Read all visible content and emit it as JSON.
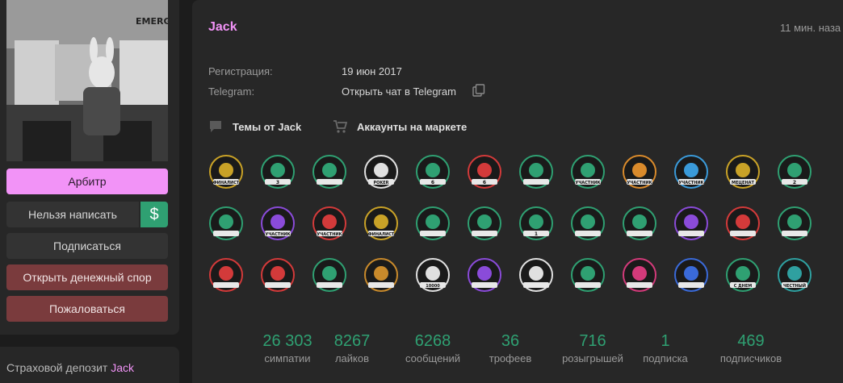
{
  "profile": {
    "username": "Jack",
    "last_seen": "11 мин. наза",
    "registration_label": "Регистрация:",
    "registration_value": "19 июн 2017",
    "telegram_label": "Telegram:",
    "telegram_value": "Открыть чат в Telegram",
    "threads_link": "Темы от Jack",
    "market_link": "Аккаунты на маркете"
  },
  "sidebar": {
    "arbiter": "Арбитр",
    "no_write": "Нельзя написать",
    "dollar": "$",
    "subscribe": "Подписаться",
    "dispute": "Открыть денежный спор",
    "complain": "Пожаловаться"
  },
  "deposit": {
    "label": "Страховой депозит",
    "name": "Jack"
  },
  "stats": [
    {
      "value": "26 303",
      "label": "симпатии"
    },
    {
      "value": "8267",
      "label": "лайков"
    },
    {
      "value": "6268",
      "label": "сообщений"
    },
    {
      "value": "36",
      "label": "трофеев"
    },
    {
      "value": "716",
      "label": "розыгрышей"
    },
    {
      "value": "1",
      "label": "подписка"
    },
    {
      "value": "469",
      "label": "подписчиков"
    }
  ],
  "trophies": [
    {
      "name": "trophy-finalist",
      "color": "#c9a227",
      "text": "ФИНАЛИСТ"
    },
    {
      "name": "trophy-3-years",
      "color": "#2fa072",
      "text": "3"
    },
    {
      "name": "trophy-truck",
      "color": "#2fa072",
      "text": ""
    },
    {
      "name": "trophy-poker",
      "color": "#e0e0e0",
      "text": "POKER"
    },
    {
      "name": "trophy-six",
      "color": "#2fa072",
      "text": "6"
    },
    {
      "name": "trophy-forum",
      "color": "#d33a3a",
      "text": "6"
    },
    {
      "name": "trophy-skull",
      "color": "#2fa072",
      "text": ""
    },
    {
      "name": "trophy-eye",
      "color": "#2fa072",
      "text": "УЧАСТНИК"
    },
    {
      "name": "trophy-pyramid",
      "color": "#d98a2b",
      "text": "УЧАСТНИК"
    },
    {
      "name": "trophy-shark",
      "color": "#3a9ad9",
      "text": "УЧАСТНИК"
    },
    {
      "name": "trophy-patron",
      "color": "#c9a227",
      "text": "МЕЦЕНАТ"
    },
    {
      "name": "trophy-2-years",
      "color": "#2fa072",
      "text": "2"
    },
    {
      "name": "trophy-triangle",
      "color": "#2fa072",
      "text": ""
    },
    {
      "name": "trophy-brain",
      "color": "#8a4bd9",
      "text": "УЧАСТНИК"
    },
    {
      "name": "trophy-valorant",
      "color": "#d33a3a",
      "text": "УЧАСТНИК"
    },
    {
      "name": "trophy-finalist-2",
      "color": "#c9a227",
      "text": "ФИНАЛИСТ"
    },
    {
      "name": "trophy-bush",
      "color": "#2fa072",
      "text": ""
    },
    {
      "name": "trophy-handshake",
      "color": "#2fa072",
      "text": ""
    },
    {
      "name": "trophy-year",
      "color": "#2fa072",
      "text": "1"
    },
    {
      "name": "trophy-elephant",
      "color": "#2fa072",
      "text": ""
    },
    {
      "name": "trophy-laurel",
      "color": "#2fa072",
      "text": ""
    },
    {
      "name": "trophy-purple",
      "color": "#8a4bd9",
      "text": ""
    },
    {
      "name": "trophy-cards",
      "color": "#d33a3a",
      "text": ""
    },
    {
      "name": "trophy-winner",
      "color": "#2fa072",
      "text": ""
    },
    {
      "name": "trophy-active",
      "color": "#d33a3a",
      "text": ""
    },
    {
      "name": "trophy-cart",
      "color": "#d33a3a",
      "text": ""
    },
    {
      "name": "trophy-arrow",
      "color": "#2fa072",
      "text": ""
    },
    {
      "name": "trophy-duck",
      "color": "#c98a2b",
      "text": ""
    },
    {
      "name": "trophy-heart-10000",
      "color": "#e0e0e0",
      "text": "10000"
    },
    {
      "name": "trophy-5000",
      "color": "#8a4bd9",
      "text": ""
    },
    {
      "name": "trophy-flag",
      "color": "#e0e0e0",
      "text": ""
    },
    {
      "name": "trophy-bulb",
      "color": "#2fa072",
      "text": ""
    },
    {
      "name": "trophy-innovator",
      "color": "#d33a7a",
      "text": ""
    },
    {
      "name": "trophy-tree",
      "color": "#3a6ad9",
      "text": ""
    },
    {
      "name": "trophy-birthday",
      "color": "#2fa072",
      "text": "С ДНЕМ"
    },
    {
      "name": "trophy-seller",
      "color": "#2fa0a0",
      "text": "ЧЕСТНЫЙ"
    }
  ],
  "colors": {
    "accent_pink": "#f293f7",
    "accent_green": "#2fa072",
    "danger": "#7a3b3d"
  }
}
